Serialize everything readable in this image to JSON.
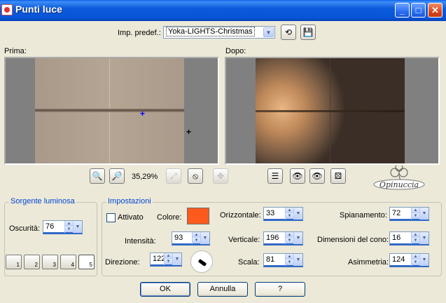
{
  "window": {
    "title": "Punti luce",
    "controls": [
      "_",
      "□",
      "✕"
    ]
  },
  "preset": {
    "label": "Imp. predef.:",
    "value": "Yoka-LIGHTS-Christmas"
  },
  "preview": {
    "before_label": "Prima:",
    "after_label": "Dopo:",
    "zoom_level": "35,29%"
  },
  "light_source": {
    "legend": "Sorgente luminosa",
    "darkness_label": "Oscurità:",
    "darkness_value": "76",
    "light_buttons": [
      "1",
      "2",
      "3",
      "4",
      "5"
    ]
  },
  "settings": {
    "legend": "Impostazioni",
    "enabled_label": "Attivato",
    "color_label": "Colore:",
    "color_value": "#FF5A1E",
    "intensity_label": "Intensità:",
    "intensity_value": "93",
    "direction_label": "Direzione:",
    "direction_value": "122",
    "horizontal_label": "Orizzontale:",
    "horizontal_value": "33",
    "vertical_label": "Verticale:",
    "vertical_value": "196",
    "scale_label": "Scala:",
    "scale_value": "81",
    "flattening_label": "Spianamento:",
    "flattening_value": "72",
    "cone_label": "Dimensioni del cono:",
    "cone_value": "16",
    "asymmetry_label": "Asimmetria:",
    "asymmetry_value": "124"
  },
  "buttons": {
    "ok": "OK",
    "cancel": "Annulla",
    "help": "?"
  },
  "logo": {
    "text": "Opinuccia"
  }
}
